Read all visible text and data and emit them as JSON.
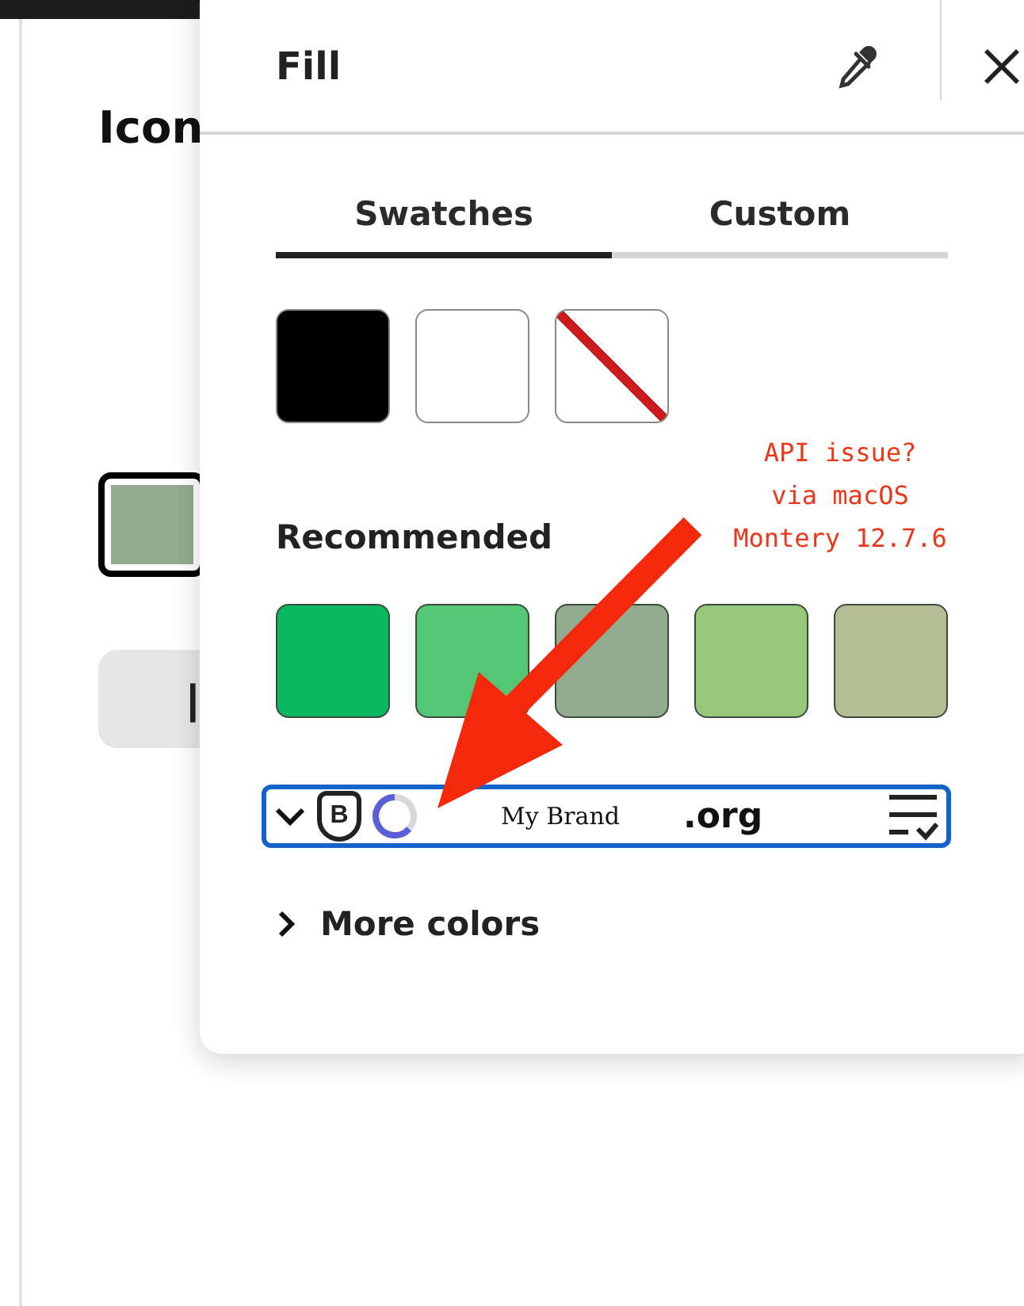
{
  "page": {
    "heading": "Icon",
    "current_swatch": {
      "color": "#93ab8f",
      "selected": true
    },
    "button_label": "|"
  },
  "panel": {
    "title": "Fill",
    "tabs": [
      {
        "label": "Swatches",
        "selected": true
      },
      {
        "label": "Custom",
        "selected": false
      }
    ],
    "swatches": [
      {
        "kind": "solid",
        "color": "#000000"
      },
      {
        "kind": "solid",
        "color": "#ffffff"
      },
      {
        "kind": "none"
      }
    ],
    "recommended": {
      "title": "Recommended",
      "swatches": [
        {
          "color": "#0bb862"
        },
        {
          "color": "#55c675"
        },
        {
          "color": "#93ab8f"
        },
        {
          "color": "#98c67a"
        },
        {
          "color": "#b3bd93"
        }
      ]
    },
    "toolbar": {
      "badge": "B",
      "brand": "My Brand",
      "domain": ".org"
    },
    "more_colors": {
      "label": "More colors",
      "expanded": false
    }
  },
  "annotation": {
    "lines": [
      "API issue?",
      "via macOS",
      "Montery 12.7.6"
    ]
  }
}
